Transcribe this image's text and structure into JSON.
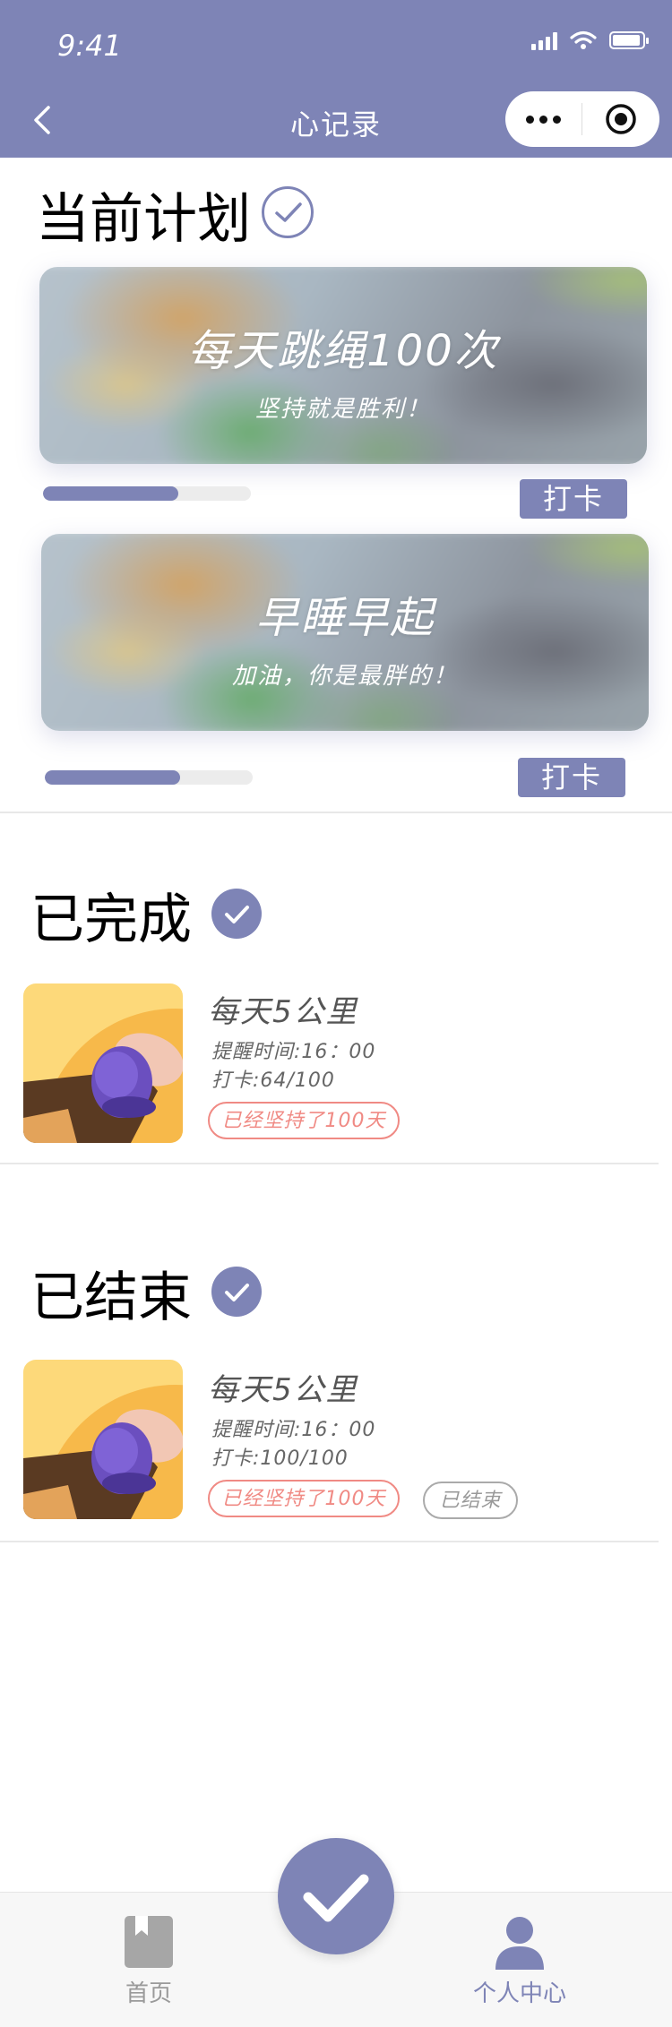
{
  "status_bar": {
    "time": "9:41"
  },
  "nav": {
    "title": "心记录"
  },
  "current_plans": {
    "heading": "当前计划",
    "plans": [
      {
        "title": "每天跳绳100次",
        "subtitle": "坚持就是胜利！",
        "progress": 0.65,
        "button": "打卡"
      },
      {
        "title": "早睡早起",
        "subtitle": "加油，你是最胖的！",
        "progress": 0.65,
        "button": "打卡"
      }
    ]
  },
  "completed": {
    "heading": "已完成",
    "items": [
      {
        "name": "每天5公里",
        "reminder": "提醒时间:16：00",
        "checkins": "打卡:64/100",
        "streak_tag": "已经坚持了100天"
      }
    ]
  },
  "ended": {
    "heading": "已结束",
    "items": [
      {
        "name": "每天5公里",
        "reminder": "提醒时间:16：00",
        "checkins": "打卡:100/100",
        "streak_tag": "已经坚持了100天",
        "status_tag": "已结束"
      }
    ]
  },
  "tabbar": {
    "home_label": "首页",
    "profile_label": "个人中心"
  },
  "colors": {
    "accent": "#7e84b6",
    "tag_red": "#f08a84",
    "tab_inactive": "#9a9a9a"
  }
}
